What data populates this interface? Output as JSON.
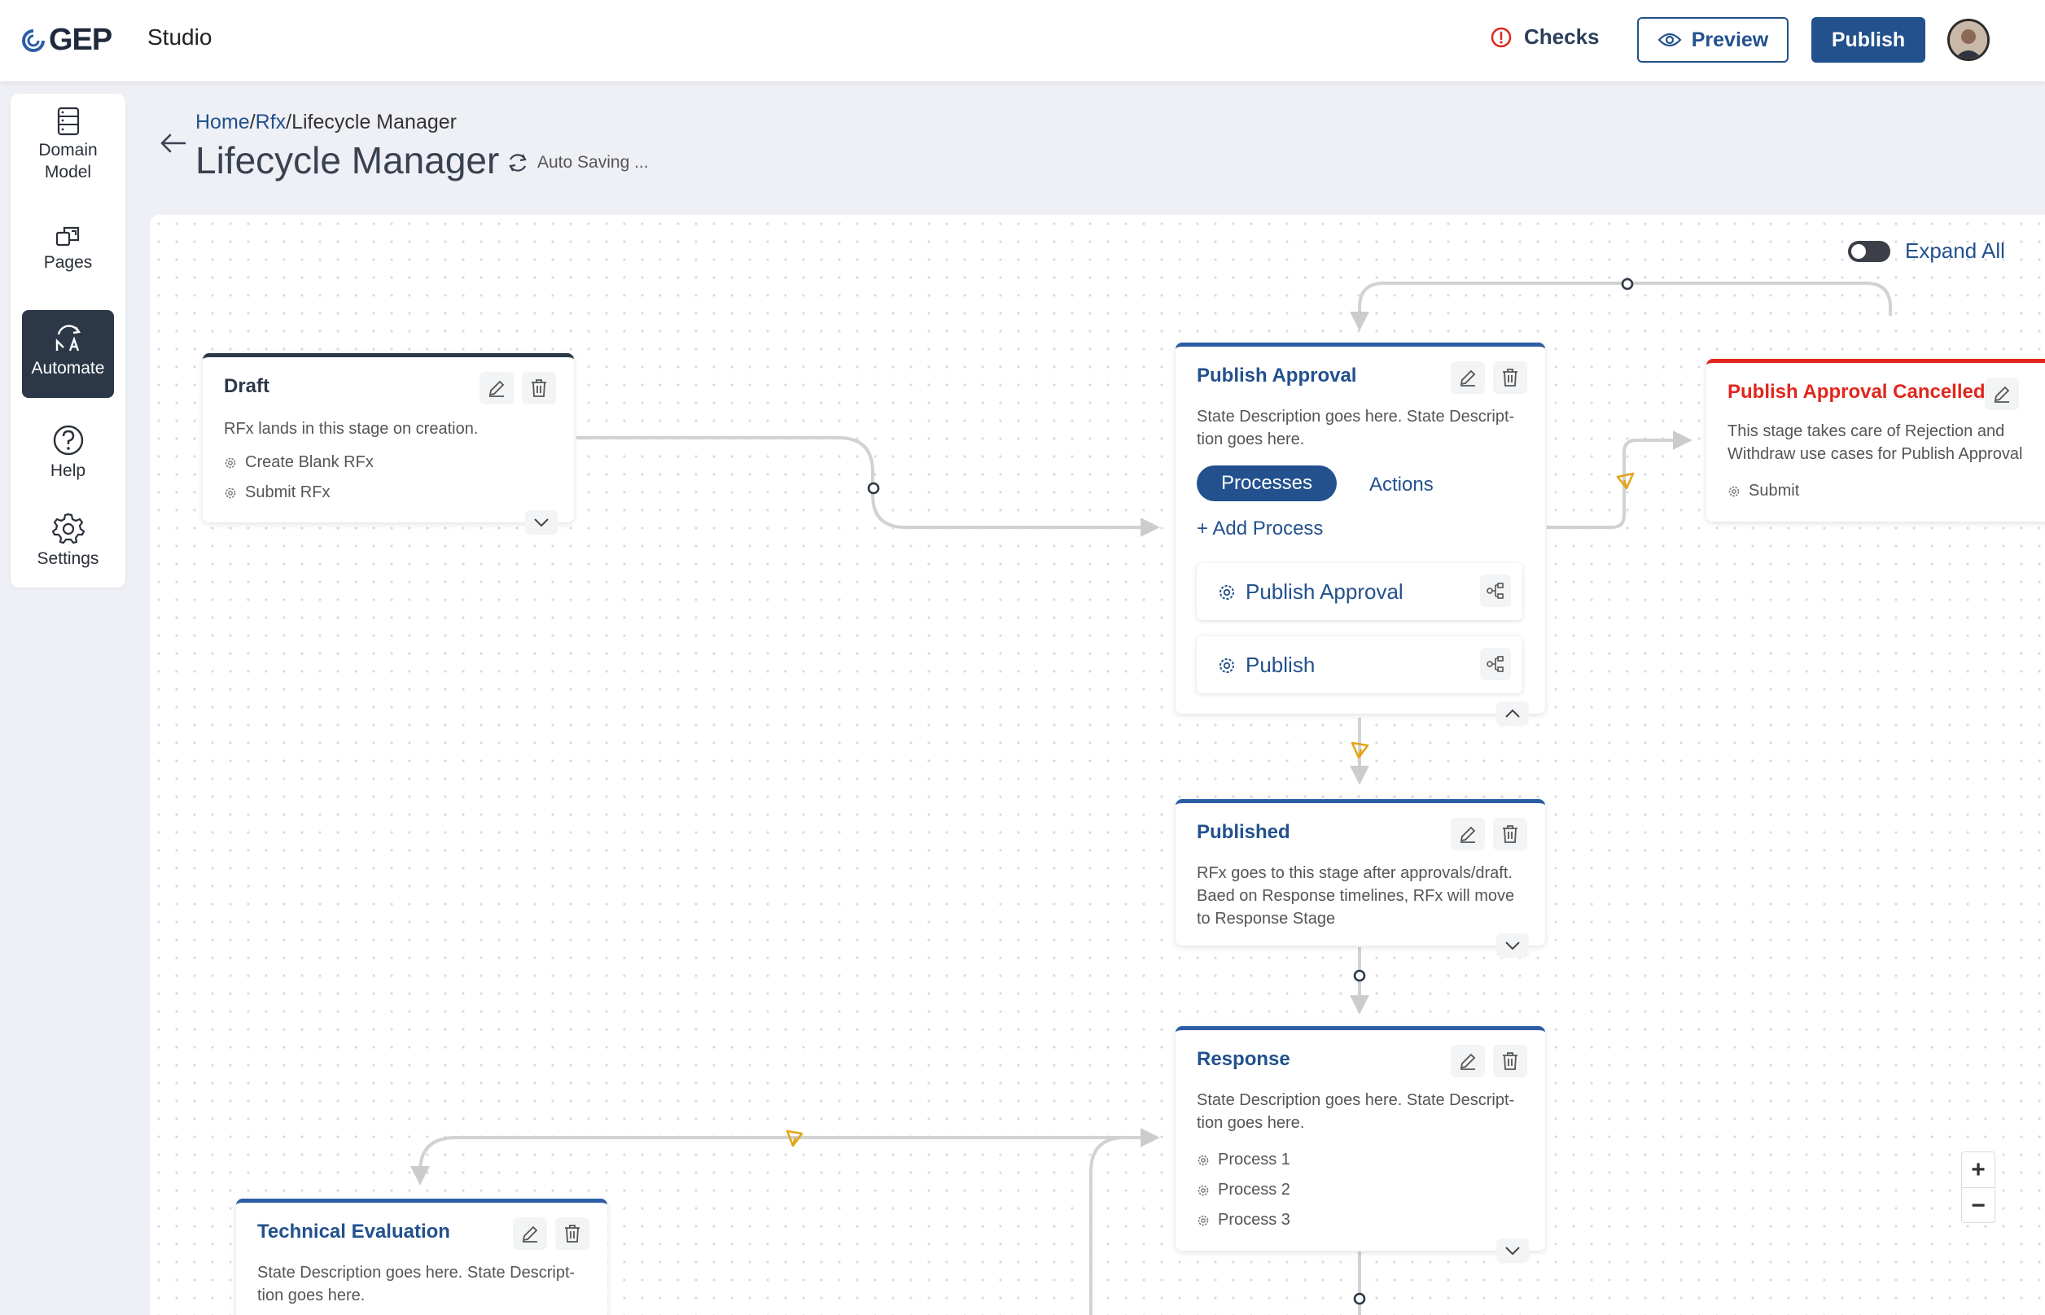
{
  "header": {
    "brand": "GEP",
    "app_name": "Studio",
    "checks_label": "Checks",
    "preview_label": "Preview",
    "publish_label": "Publish"
  },
  "nav": {
    "items": [
      {
        "label": "Domain Model",
        "icon": "domain-model-icon"
      },
      {
        "label": "Pages",
        "icon": "pages-icon"
      },
      {
        "label": "Automate",
        "icon": "automate-icon",
        "active": true
      },
      {
        "label": "Help",
        "icon": "help-icon"
      },
      {
        "label": "Settings",
        "icon": "settings-icon"
      }
    ]
  },
  "breadcrumb": {
    "home": "Home",
    "sep1": "/",
    "rfx": "Rfx",
    "sep2": "/",
    "current": "Lifecycle Manager"
  },
  "page": {
    "title": "Lifecycle Manager",
    "autosave": "Auto Saving ..."
  },
  "canvas": {
    "expand_all_label": "Expand All",
    "expand_all_on": false
  },
  "stages": {
    "draft": {
      "title": "Draft",
      "description": "RFx lands in this stage on creation.",
      "processes": [
        "Create Blank RFx",
        "Submit RFx"
      ]
    },
    "publish_approval": {
      "title": "Publish Approval",
      "description_1": "State Description goes here. State Descript-",
      "description_2": "tion goes here.",
      "tab_processes": "Processes",
      "tab_actions": "Actions",
      "add_process": "+ Add Process",
      "processes": [
        "Publish Approval",
        "Publish"
      ]
    },
    "publish_approval_cancelled": {
      "title": "Publish Approval Cancelled",
      "description_1": "This stage takes care of Rejection and",
      "description_2": "Withdraw use cases for Publish Approval",
      "processes": [
        "Submit"
      ]
    },
    "published": {
      "title": "Published",
      "description_1": "RFx goes to this stage after approvals/draft.",
      "description_2": "Baed on Response timelines, RFx will move",
      "description_3": "to Response Stage"
    },
    "response": {
      "title": "Response",
      "description_1": "State Description goes here. State Descript-",
      "description_2": "tion goes here.",
      "processes": [
        "Process 1",
        "Process 2",
        "Process 3"
      ]
    },
    "technical_evaluation": {
      "title": "Technical Evaluation",
      "description_1": "State Description goes here. State Descript-",
      "description_2": "tion goes here."
    }
  },
  "zoom": {
    "in": "+",
    "out": "−"
  },
  "colors": {
    "primary": "#22518d",
    "danger": "#e0261c",
    "dark": "#2c3848",
    "connector": "#cfcfcf",
    "action_marker": "#e2a51b"
  }
}
